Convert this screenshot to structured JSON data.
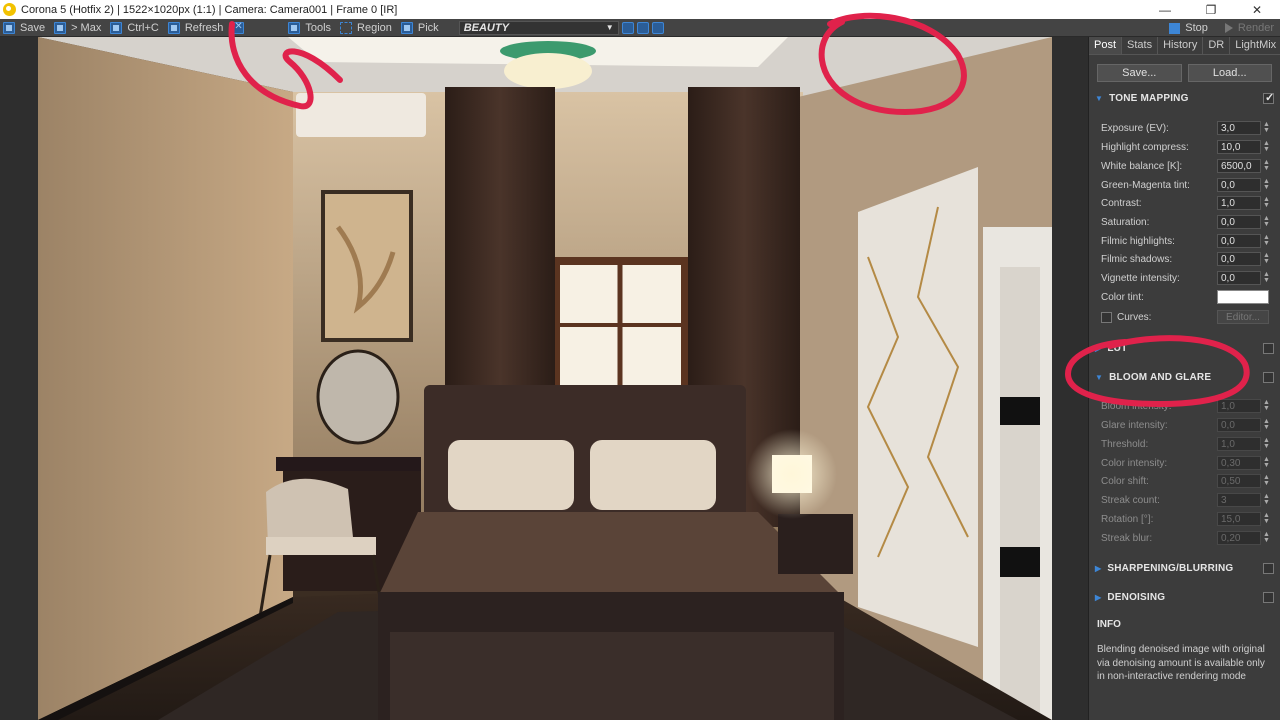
{
  "window": {
    "title": "Corona 5 (Hotfix 2) | 1522×1020px (1:1) | Camera: Camera001 | Frame 0 [IR]",
    "minimize": "—",
    "maximize": "❐",
    "close": "✕"
  },
  "toolbar": {
    "save": "Save",
    "max": "> Max",
    "ctrlc": "Ctrl+C",
    "refresh": "Refresh",
    "clear": "",
    "tools": "Tools",
    "region": "Region",
    "pick": "Pick",
    "pass_select": "BEAUTY",
    "stop": "Stop",
    "render": "Render"
  },
  "tabs": [
    "Post",
    "Stats",
    "History",
    "DR",
    "LightMix"
  ],
  "panel": {
    "save_btn": "Save...",
    "load_btn": "Load...",
    "tone_mapping": {
      "title": "TONE MAPPING",
      "params": [
        {
          "label": "Exposure (EV):",
          "value": "3,0"
        },
        {
          "label": "Highlight compress:",
          "value": "10,0"
        },
        {
          "label": "White balance [K]:",
          "value": "6500,0"
        },
        {
          "label": "Green-Magenta tint:",
          "value": "0,0"
        },
        {
          "label": "Contrast:",
          "value": "1,0"
        },
        {
          "label": "Saturation:",
          "value": "0,0"
        },
        {
          "label": "Filmic highlights:",
          "value": "0,0"
        },
        {
          "label": "Filmic shadows:",
          "value": "0,0"
        },
        {
          "label": "Vignette intensity:",
          "value": "0,0"
        }
      ],
      "color_tint": "Color tint:",
      "curves": "Curves:",
      "editor": "Editor..."
    },
    "lut_title": "LUT",
    "bloom": {
      "title": "BLOOM AND GLARE",
      "params": [
        {
          "label": "Bloom intensity:",
          "value": "1,0"
        },
        {
          "label": "Glare intensity:",
          "value": "0,0"
        },
        {
          "label": "Threshold:",
          "value": "1,0"
        },
        {
          "label": "Color intensity:",
          "value": "0,30"
        },
        {
          "label": "Color shift:",
          "value": "0,50"
        },
        {
          "label": "Streak count:",
          "value": "3"
        },
        {
          "label": "Rotation [°]:",
          "value": "15,0"
        },
        {
          "label": "Streak blur:",
          "value": "0,20"
        }
      ]
    },
    "sharpening_title": "SHARPENING/BLURRING",
    "denoising_title": "DENOISING",
    "info_title": "INFO",
    "info_text": "Blending denoised image with original via denoising amount is available only in non-interactive rendering mode"
  },
  "colors": {
    "accent": "#3d86d6",
    "annotation": "#e0224b"
  }
}
